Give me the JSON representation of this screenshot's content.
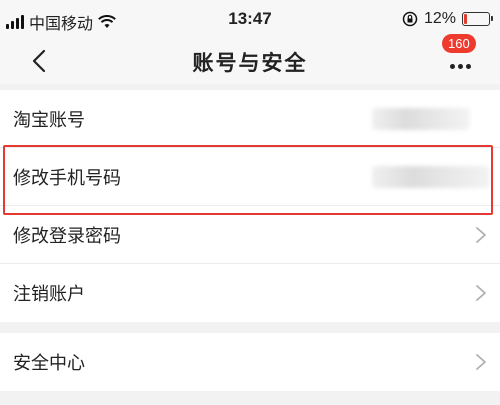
{
  "status_bar": {
    "carrier": "中国移动",
    "time": "13:47",
    "battery_percent": "12%",
    "battery_level": 0.12
  },
  "nav": {
    "title": "账号与安全",
    "badge_count": "160",
    "back_icon": "chevron-left-icon",
    "more_icon": "more-dots-icon"
  },
  "groups": [
    {
      "rows": [
        {
          "label": "淘宝账号",
          "value_obscured": true
        },
        {
          "label": "修改手机号码",
          "value_obscured": true,
          "highlighted": true
        },
        {
          "label": "修改登录密码"
        },
        {
          "label": "注销账户"
        }
      ]
    },
    {
      "rows": [
        {
          "label": "安全中心"
        }
      ]
    }
  ],
  "colors": {
    "accent_red": "#e33b33",
    "badge_red": "#ef3b2e",
    "background": "#f2f2f2"
  }
}
